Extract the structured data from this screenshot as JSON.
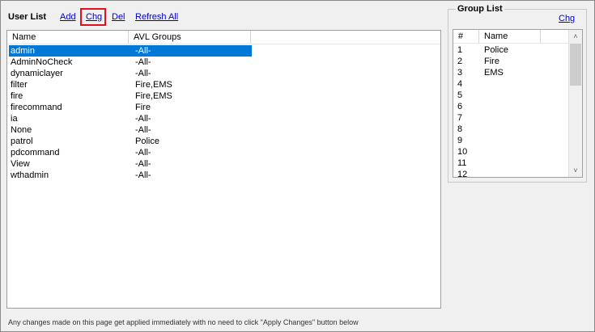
{
  "toolbar": {
    "title": "User List",
    "add_label": "Add",
    "chg_label": "Chg",
    "del_label": "Del",
    "refresh_label": "Refresh All"
  },
  "user_list": {
    "columns": [
      "Name",
      "AVL Groups"
    ],
    "rows": [
      {
        "name": "admin",
        "groups": "-All-",
        "selected": true
      },
      {
        "name": "AdminNoCheck",
        "groups": "-All-"
      },
      {
        "name": "dynamiclayer",
        "groups": "-All-"
      },
      {
        "name": "filter",
        "groups": "Fire,EMS"
      },
      {
        "name": "fire",
        "groups": "Fire,EMS"
      },
      {
        "name": "firecommand",
        "groups": "Fire"
      },
      {
        "name": "ia",
        "groups": "-All-"
      },
      {
        "name": "None",
        "groups": "-All-"
      },
      {
        "name": "patrol",
        "groups": "Police"
      },
      {
        "name": "pdcommand",
        "groups": "-All-"
      },
      {
        "name": "View",
        "groups": "-All-"
      },
      {
        "name": "wthadmin",
        "groups": "-All-"
      }
    ],
    "selection_color": "#0078d7"
  },
  "footer_note": "Any changes made on this page get applied immediately with no need to click \"Apply Changes\" button below",
  "group_list": {
    "title": "Group List",
    "chg_label": "Chg",
    "columns": [
      "#",
      "Name"
    ],
    "rows": [
      {
        "num": "1",
        "name": "Police"
      },
      {
        "num": "2",
        "name": "Fire"
      },
      {
        "num": "3",
        "name": "EMS"
      },
      {
        "num": "4",
        "name": ""
      },
      {
        "num": "5",
        "name": ""
      },
      {
        "num": "6",
        "name": ""
      },
      {
        "num": "7",
        "name": ""
      },
      {
        "num": "8",
        "name": ""
      },
      {
        "num": "9",
        "name": ""
      },
      {
        "num": "10",
        "name": ""
      },
      {
        "num": "11",
        "name": ""
      },
      {
        "num": "12",
        "name": ""
      }
    ]
  },
  "icons": {
    "scroll_up": "chevron-up-icon",
    "scroll_down": "chevron-down-icon"
  },
  "colors": {
    "link": "#0000cc",
    "highlight": "#e0101c"
  }
}
